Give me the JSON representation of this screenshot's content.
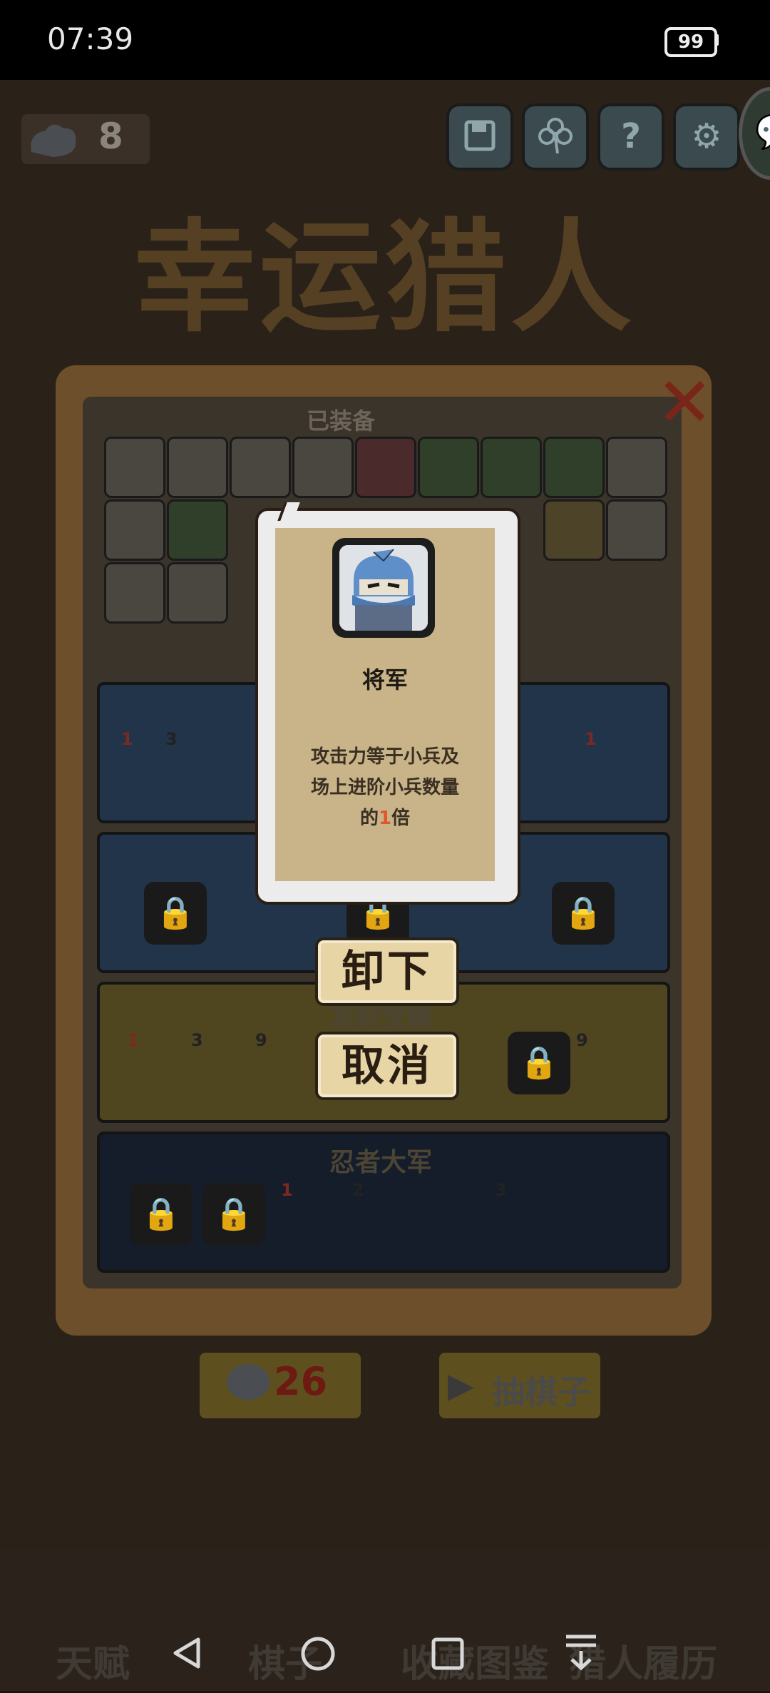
{
  "status_bar": {
    "time": "07:39",
    "battery": "99"
  },
  "top_bar": {
    "gem_count": "8"
  },
  "title": {
    "text": "幸运猎人"
  },
  "panel": {
    "equipped_label": "已装备",
    "row_badges": [
      "1",
      "3",
      "1"
    ],
    "treasure_title": "发财宝箱",
    "treasure_badges": [
      "1",
      "3",
      "9",
      "9"
    ],
    "ninja_title": "忍者大军",
    "ninja_badges": [
      "1",
      "2",
      "3"
    ]
  },
  "bottom_buttons": {
    "gems": "26",
    "draw": "抽棋子"
  },
  "game_nav": {
    "items": [
      "天赋",
      "棋子",
      "收藏图鉴",
      "猎人履历"
    ]
  },
  "modal": {
    "title": "将军",
    "desc_line1": "攻击力等于小兵及",
    "desc_line2": "场上进阶小兵数量",
    "desc_pre": "的",
    "desc_num": "1",
    "desc_post": "倍",
    "accent_color": "#e2562a"
  },
  "actions": {
    "unequip": "卸下",
    "cancel": "取消"
  },
  "icons": [
    "save-icon",
    "clover-icon",
    "help-icon",
    "gear-icon",
    "chat-icon",
    "lock-icon",
    "back-icon",
    "home-icon",
    "recents-icon",
    "menu-icon"
  ]
}
